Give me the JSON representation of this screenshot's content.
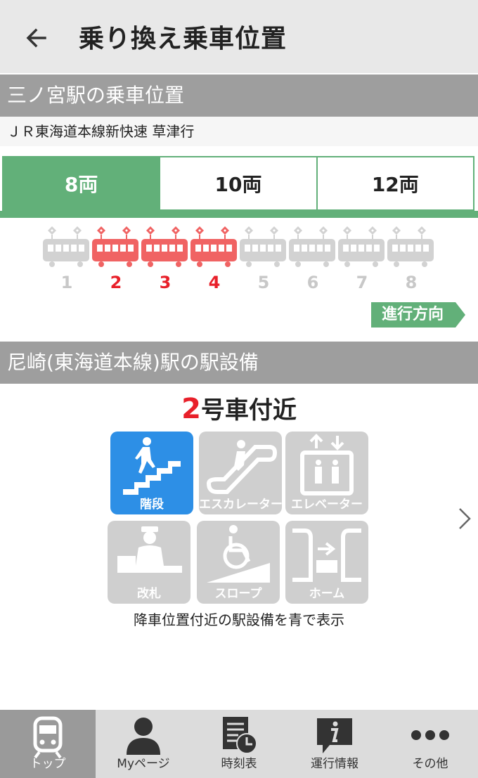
{
  "appbar": {
    "title": "乗り換え乗車位置"
  },
  "boarding": {
    "header": "三ノ宮駅の乗車位置",
    "line_info": "ＪＲ東海道本線新快速  草津行",
    "tabs": [
      {
        "label": "8両",
        "active": true
      },
      {
        "label": "10両",
        "active": false
      },
      {
        "label": "12両",
        "active": false
      }
    ],
    "cars": [
      {
        "number": "1",
        "highlighted": false
      },
      {
        "number": "2",
        "highlighted": true
      },
      {
        "number": "3",
        "highlighted": true
      },
      {
        "number": "4",
        "highlighted": true
      },
      {
        "number": "5",
        "highlighted": false
      },
      {
        "number": "6",
        "highlighted": false
      },
      {
        "number": "7",
        "highlighted": false
      },
      {
        "number": "8",
        "highlighted": false
      }
    ],
    "direction_label": "進行方向"
  },
  "facilities": {
    "header": "尼崎(東海道本線)駅の駅設備",
    "near_car_number": "2",
    "near_car_suffix": "号車付近",
    "items": [
      {
        "label": "階段",
        "icon": "stairs-icon",
        "active": true
      },
      {
        "label": "エスカレーター",
        "icon": "escalator-icon",
        "active": false
      },
      {
        "label": "エレベーター",
        "icon": "elevator-icon",
        "active": false
      },
      {
        "label": "改札",
        "icon": "ticket-gate-icon",
        "active": false
      },
      {
        "label": "スロープ",
        "icon": "slope-icon",
        "active": false
      },
      {
        "label": "ホーム",
        "icon": "platform-icon",
        "active": false
      }
    ],
    "caption": "降車位置付近の駅設備を青で表示"
  },
  "bottom_nav": [
    {
      "label": "トップ",
      "icon": "train-icon",
      "active": true
    },
    {
      "label": "Myページ",
      "icon": "person-icon",
      "active": false
    },
    {
      "label": "時刻表",
      "icon": "timetable-icon",
      "active": false
    },
    {
      "label": "運行情報",
      "icon": "info-icon",
      "active": false
    },
    {
      "label": "その他",
      "icon": "more-icon",
      "active": false
    }
  ],
  "colors": {
    "accent_green": "#62b079",
    "highlight_red": "#f06363",
    "car_gray": "#d2d2d2",
    "active_blue": "#2d8fe6",
    "header_gray": "#9e9e9e"
  }
}
